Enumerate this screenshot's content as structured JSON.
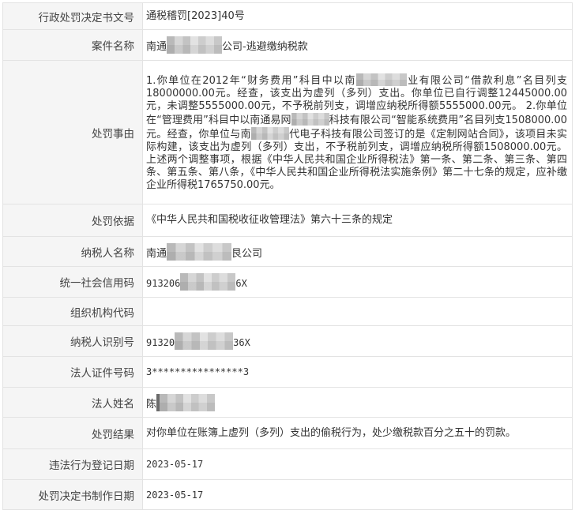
{
  "rows": [
    {
      "label": "行政处罚决定书文号",
      "value": "通税稽罚[2023]40号"
    },
    {
      "label": "案件名称",
      "value_prefix": "南通",
      "value_suffix": "公司-逃避缴纳税款"
    },
    {
      "label": "处罚事由",
      "p1": "1.你单位在2012年“财务费用”科目中以南",
      "p2": "业有限公司“借款利息”名目列支18000000.00元。经查，该支出为虚列（多列）支出。你单位已自行调整12445000.00元，未调整5555000.00元，不予税前列支，调增应纳税所得额5555000.00元。 2.你单位在“管理费用”科目中以南通易网",
      "p3": "科技有限公司“智能系统费用”名目列支1508000.00元。经查，你单位与南",
      "p4": "代电子科技有限公司签订的是《定制网站合同》，该项目未实际构建，该支出为虚列（多列）支出，不予税前列支，调增应纳税所得额1508000.00元。 上述两个调整事项，根据《中华人民共和国企业所得税法》第一条、第二条、第三条、第四条、第五条、第八条，《中华人民共和国企业所得税法实施条例》第二十七条的规定，应补缴企业所得税1765750.00元。"
    },
    {
      "label": "处罚依据",
      "value": "《中华人民共和国税收征收管理法》第六十三条的规定"
    },
    {
      "label": "纳税人名称",
      "value_prefix": "南通",
      "value_suffix": "艮公司"
    },
    {
      "label": "统一社会信用码",
      "value_prefix": "913206",
      "value_suffix": "6X"
    },
    {
      "label": "组织机构代码",
      "value": ""
    },
    {
      "label": "纳税人识别号",
      "value_prefix": "91320",
      "value_suffix": "36X"
    },
    {
      "label": "法人证件号码",
      "value": "3****************3"
    },
    {
      "label": "法人姓名",
      "value_prefix": "陈",
      "value_suffix": ""
    },
    {
      "label": "处罚结果",
      "value": "对你单位在账簿上虚列（多列）支出的偷税行为，处少缴税款百分之五十的罚款。"
    },
    {
      "label": "违法行为登记日期",
      "value": "2023-05-17"
    },
    {
      "label": "处罚决定书制作日期",
      "value": "2023-05-17"
    }
  ]
}
